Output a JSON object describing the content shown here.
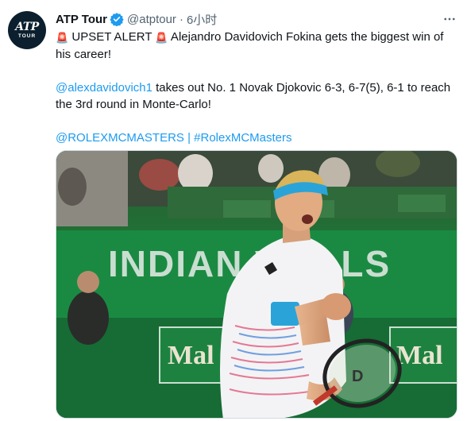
{
  "tweet": {
    "display_name": "ATP Tour",
    "handle": "@atptour",
    "separator": "·",
    "time": "6小时",
    "line1": {
      "siren1": "🚨",
      "alert": " UPSET ALERT ",
      "siren2": "🚨",
      "text": " Alejandro Davidovich Fokina gets the biggest win of",
      "text_cont": "his career!"
    },
    "line2": {
      "mention": "@alexdavidovich1",
      "text": " takes out No. 1 Novak Djokovic 6-3, 6-7(5), 6-1 to reach",
      "text_cont": "the 3rd round in Monte-Carlo!"
    },
    "line3": {
      "mention": "@ROLEXMCMASTERS",
      "sep": " | ",
      "hashtag": "#RolexMCMasters"
    }
  },
  "avatar": {
    "logo_top": "ATP",
    "logo_bottom": "TOUR"
  },
  "media": {
    "banner_text": "INDIAN WELLS",
    "board_left": "Mal",
    "board_right": "Mal",
    "racket_brand": "D"
  },
  "icons": {
    "verified": "verified-badge-icon",
    "more": "more-options-icon"
  },
  "colors": {
    "link": "#1d9bf0",
    "verified": "#1d9bf0",
    "muted": "#536471"
  }
}
